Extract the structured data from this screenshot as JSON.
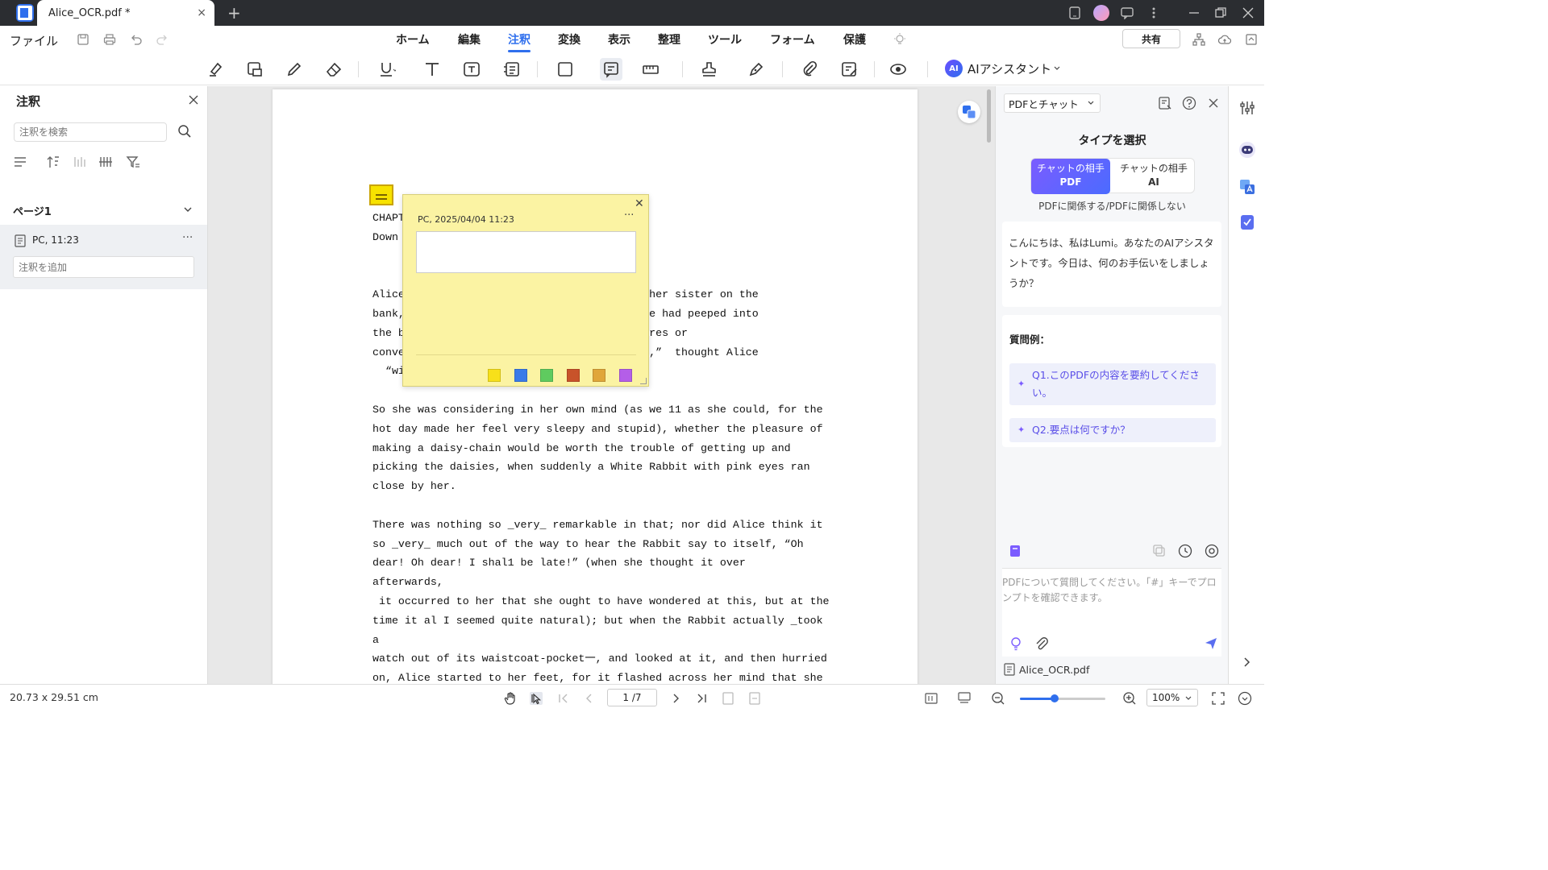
{
  "window": {
    "tab_title": "Alice_OCR.pdf *",
    "tab_close": "×",
    "new_tab": "+"
  },
  "menu": {
    "file": "ファイル",
    "tabs": [
      "ホーム",
      "編集",
      "注釈",
      "変換",
      "表示",
      "整理",
      "ツール",
      "フォーム",
      "保護"
    ],
    "active_tab": "注釈",
    "share": "共有"
  },
  "toolbar": {
    "ai_assistant": "AIアシスタント",
    "ai_badge": "AI",
    "accent_color": "#2f6fed"
  },
  "left_panel": {
    "title": "注釈",
    "search_placeholder": "注釈を検索",
    "page_group": "ページ1",
    "item_label": "PC,  11:23",
    "item_more": "···",
    "add_note_placeholder": "注釈を追加"
  },
  "document": {
    "lines": [
      "CHAPTE",
      "Down t",
      "",
      "",
      "Alice                                    y her sister on the",
      "bank,                                    she had peeped into",
      "the bo                                   tures or",
      "conver                                   ok,”  thought Alice",
      "  “wi",
      "",
      "So she was considering in her own mind (as we 11 as she could, for the",
      "hot day made her feel very sleepy and stupid), whether the pleasure of",
      "making a daisy-chain would be worth the trouble of getting up and",
      "picking the daisies, when suddenly a White Rabbit with pink eyes ran",
      "close by her.",
      "",
      "There was nothing so _very_ remarkable in that; nor did Alice think it",
      "so _very_ much out of the way to hear the Rabbit say to itself, “Oh",
      "dear! Oh dear! I shal1 be late!” (when she thought it over",
      "afterwards,",
      " it occurred to her that she ought to have wondered at this, but at the",
      "time it al I seemed quite natural); but when the Rabbit actually _took",
      "a",
      "watch out of its waistcoat-pocket一, and looked at it, and then hurried",
      "on, Alice started to her feet, for it flashed across her mind that she"
    ]
  },
  "sticky_note": {
    "author_time": "PC,  2025/04/04 11:23",
    "more": "···",
    "close": "✕",
    "colors": [
      "#f7e01a",
      "#3a7be8",
      "#5fcb5f",
      "#c8532a",
      "#e0a63a",
      "#b45ee8"
    ],
    "note_color": "#f7e200"
  },
  "ai_panel": {
    "mode": "PDFとチャット",
    "type_title": "タイプを選択",
    "seg_pdf_line1": "チャットの相手",
    "seg_pdf_line2": "PDF",
    "seg_ai_line1": "チャットの相手",
    "seg_ai_line2": "AI",
    "type_sub": "PDFに関係する/PDFに関係しない",
    "greeting": "こんにちは、私はLumi。あなたのAIアシスタントです。今日は、何のお手伝いをしましょうか？",
    "examples_title": "質問例：",
    "examples": [
      "Q1.このPDFの内容を要約してください。",
      "Q2.要点は何ですか？"
    ],
    "prompt_placeholder": "PDFについて質問してください。「#」キーでプロンプトを確認できます。",
    "file_name": "Alice_OCR.pdf"
  },
  "status_bar": {
    "page_size": "20.73 x 29.51 cm",
    "page_indicator": "1 /7",
    "zoom": "100%",
    "zoom_fraction": 0.41
  }
}
